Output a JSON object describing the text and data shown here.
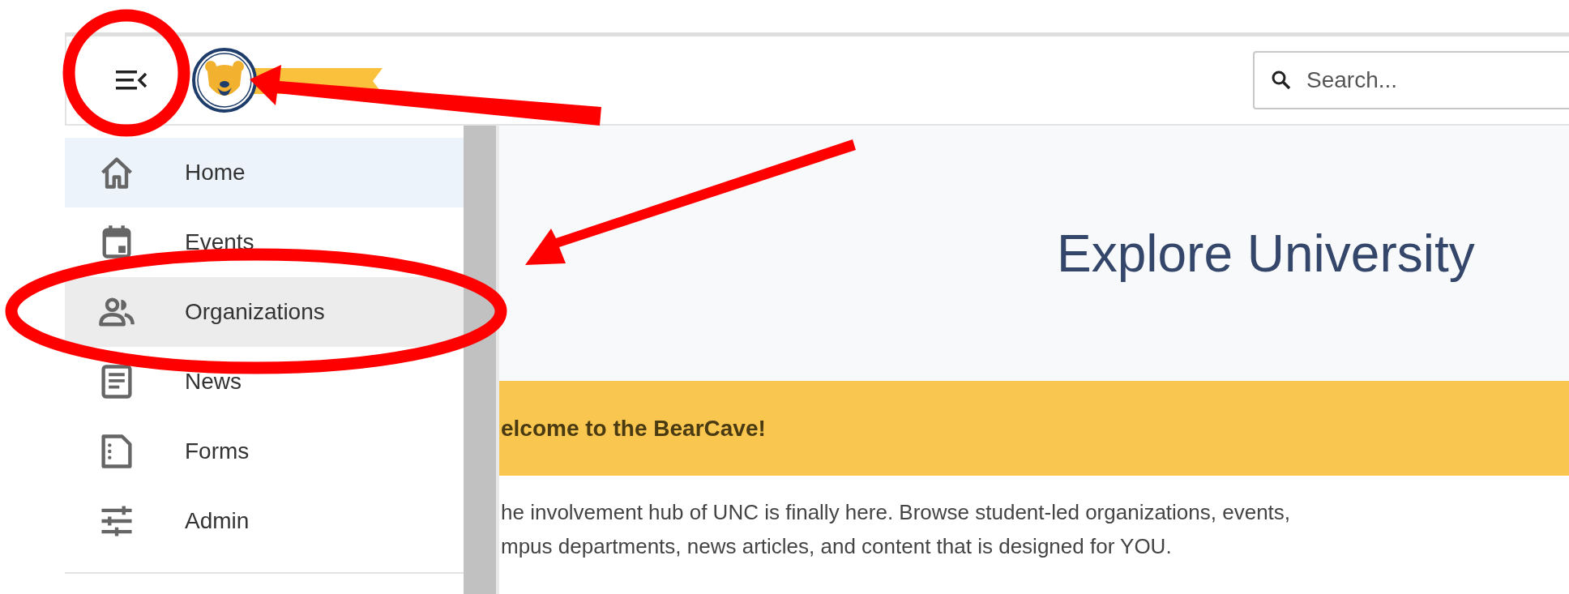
{
  "header": {
    "search": {
      "placeholder": "Search..."
    }
  },
  "sidebar": {
    "items": [
      {
        "label": "Home",
        "selected": true,
        "highlighted": false
      },
      {
        "label": "Events",
        "selected": false,
        "highlighted": false
      },
      {
        "label": "Organizations",
        "selected": false,
        "highlighted": true
      },
      {
        "label": "News",
        "selected": false,
        "highlighted": false
      },
      {
        "label": "Forms",
        "selected": false,
        "highlighted": false
      },
      {
        "label": "Admin",
        "selected": false,
        "highlighted": false
      }
    ]
  },
  "hero": {
    "title": "Explore University"
  },
  "banner": {
    "text": "elcome to the BearCave!"
  },
  "intro": {
    "lines": [
      "he involvement hub of UNC is finally here. Browse student-led organizations, events,",
      "mpus departments, news articles, and content that is designed for YOU."
    ]
  }
}
